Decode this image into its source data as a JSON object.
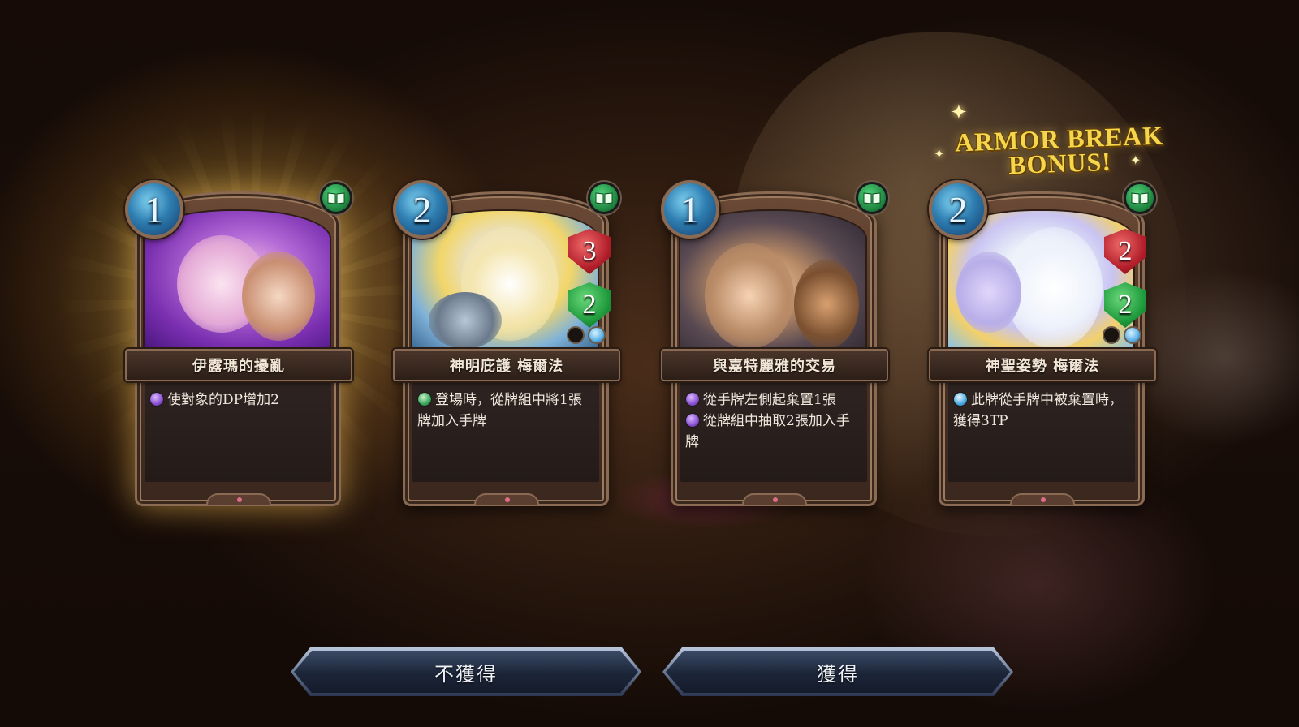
{
  "cards": [
    {
      "cost": "1",
      "name": "伊露瑪的擾亂",
      "effects": [
        {
          "icon": "purple",
          "text": "使對象的DP增加2"
        }
      ],
      "attack": "",
      "defense": ""
    },
    {
      "cost": "2",
      "name": "神明庇護 梅爾法",
      "effects": [
        {
          "icon": "green",
          "text": "登場時，從牌組中將1張牌加入手牌"
        }
      ],
      "attack": "3",
      "defense": "2"
    },
    {
      "cost": "1",
      "name": "與嘉特麗雅的交易",
      "effects": [
        {
          "icon": "purple",
          "text": "從手牌左側起棄置1張"
        },
        {
          "icon": "purple",
          "text": "從牌組中抽取2張加入手牌"
        }
      ],
      "attack": "",
      "defense": ""
    },
    {
      "cost": "2",
      "name": "神聖姿勢 梅爾法",
      "effects": [
        {
          "icon": "blue",
          "text": "此牌從手牌中被棄置時，獲得3TP"
        }
      ],
      "attack": "2",
      "defense": "2"
    }
  ],
  "bonus": {
    "line1": "ARMOR BREAK",
    "line2": "BONUS!"
  },
  "buttons": {
    "decline": "不獲得",
    "accept": "獲得"
  },
  "icons": {
    "cost": "cost-gem-icon",
    "book": "book-icon",
    "attack": "attack-shield-icon",
    "defense": "defense-shield-icon"
  },
  "colors": {
    "book_green": "#1c7f3c",
    "attack_red": "#b21e2a",
    "defense_green": "#1e9a3c",
    "cost_blue": "#2f7fb2",
    "bonus_gold": "#f6d64a"
  }
}
